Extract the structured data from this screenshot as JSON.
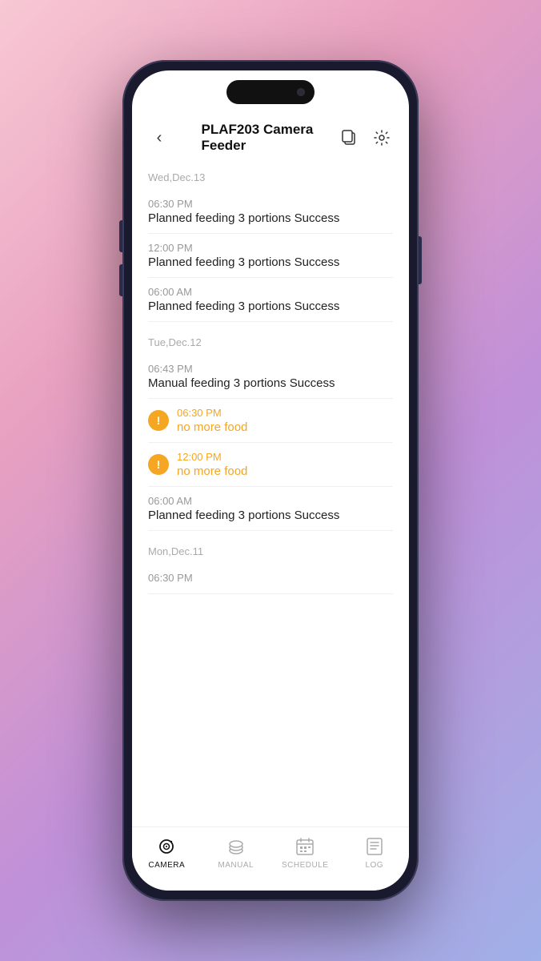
{
  "phone": {
    "header": {
      "back_label": "‹",
      "title": "PLAF203 Camera Feeder"
    },
    "sections": [
      {
        "date": "Wed,Dec.13",
        "items": [
          {
            "time": "06:30 PM",
            "desc": "Planned feeding 3 portions Success",
            "error": false
          },
          {
            "time": "12:00 PM",
            "desc": "Planned feeding 3 portions Success",
            "error": false
          },
          {
            "time": "06:00 AM",
            "desc": "Planned feeding 3 portions Success",
            "error": false
          }
        ]
      },
      {
        "date": "Tue,Dec.12",
        "items": [
          {
            "time": "06:43 PM",
            "desc": "Manual feeding 3 portions Success",
            "error": false
          },
          {
            "time": "06:30 PM",
            "desc": "no more food",
            "error": true
          },
          {
            "time": "12:00 PM",
            "desc": "no more food",
            "error": true
          },
          {
            "time": "06:00 AM",
            "desc": "Planned feeding 3 portions Success",
            "error": false
          }
        ]
      },
      {
        "date": "Mon,Dec.11",
        "items": [
          {
            "time": "06:30 PM",
            "desc": "",
            "error": false
          }
        ]
      }
    ],
    "tabs": [
      {
        "label": "CAMERA",
        "active": true
      },
      {
        "label": "MANUAL",
        "active": false
      },
      {
        "label": "SCHEDULE",
        "active": false
      },
      {
        "label": "LOG",
        "active": false
      }
    ],
    "colors": {
      "accent": "#f5a623",
      "active_tab": "#111111",
      "inactive_tab": "#aaaaaa"
    }
  }
}
